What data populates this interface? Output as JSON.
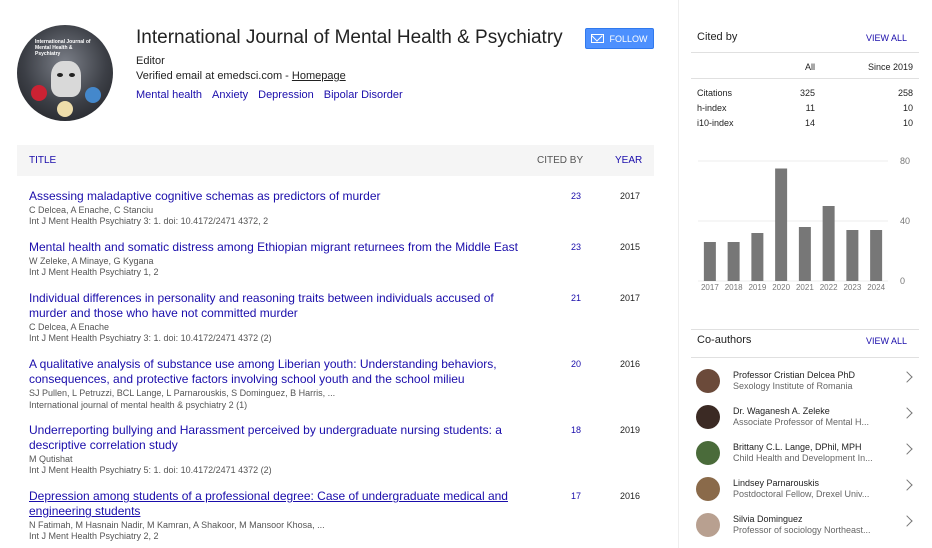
{
  "profile": {
    "name": "International Journal of Mental Health & Psychiatry",
    "role": "Editor",
    "verified_prefix": "Verified email at emedsci.com - ",
    "homepage_label": "Homepage",
    "tags": [
      "Mental health",
      "Anxiety",
      "Depression",
      "Bipolar Disorder"
    ],
    "follow_label": "FOLLOW",
    "cover_text": "International Journal of Mental Health & Psychiatry"
  },
  "table": {
    "col_title": "TITLE",
    "col_cited": "CITED BY",
    "col_year": "YEAR"
  },
  "articles": [
    {
      "title": "Assessing maladaptive cognitive schemas as predictors of murder",
      "authors": "C Delcea, A Enache, C Stanciu",
      "venue": "Int J Ment Health Psychiatry 3: 1. doi: 10.4172/2471 4372, 2",
      "cited_by": "23",
      "year": "2017"
    },
    {
      "title": "Mental health and somatic distress among Ethiopian migrant returnees from the Middle East",
      "authors": "W Zeleke, A Minaye, G Kygana",
      "venue": "Int J Ment Health Psychiatry 1, 2",
      "cited_by": "23",
      "year": "2015"
    },
    {
      "title": "Individual differences in personality and reasoning traits between individuals accused of murder and those who have not committed murder",
      "authors": "C Delcea, A Enache",
      "venue": "Int J Ment Health Psychiatry 3: 1. doi: 10.4172/2471 4372 (2)",
      "cited_by": "21",
      "year": "2017"
    },
    {
      "title": "A qualitative analysis of substance use among Liberian youth: Understanding behaviors, consequences, and protective factors involving school youth and the school milieu",
      "authors": "SJ Pullen, L Petruzzi, BCL Lange, L Parnarouskis, S Dominguez, B Harris, ...",
      "venue": "International journal of mental health & psychiatry 2 (1)",
      "cited_by": "20",
      "year": "2016"
    },
    {
      "title": "Underreporting bullying and Harassment perceived by undergraduate nursing students: a descriptive correlation study",
      "authors": "M Qutishat",
      "venue": "Int J Ment Health Psychiatry 5: 1. doi: 10.4172/2471 4372 (2)",
      "cited_by": "18",
      "year": "2019"
    },
    {
      "title": "Depression among students of a professional degree: Case of undergraduate medical and engineering students",
      "authors": "N Fatimah, M Hasnain Nadir, M Kamran, A Shakoor, M Mansoor Khosa, ...",
      "venue": "Int J Ment Health Psychiatry 2, 2",
      "cited_by": "17",
      "year": "2016"
    }
  ],
  "cited_by": {
    "heading": "Cited by",
    "view_all": "VIEW ALL",
    "col_all": "All",
    "col_since": "Since 2019",
    "rows": [
      {
        "label": "Citations",
        "all": "325",
        "since": "258"
      },
      {
        "label": "h-index",
        "all": "11",
        "since": "10"
      },
      {
        "label": "i10-index",
        "all": "14",
        "since": "10"
      }
    ]
  },
  "chart_data": {
    "type": "bar",
    "categories": [
      "2017",
      "2018",
      "2019",
      "2020",
      "2021",
      "2022",
      "2023",
      "2024"
    ],
    "values": [
      26,
      26,
      32,
      75,
      36,
      50,
      34,
      34
    ],
    "yticks": [
      "80",
      "40",
      "0"
    ],
    "ylim": [
      0,
      80
    ],
    "bar_color": "#777777"
  },
  "coauthors": {
    "heading": "Co-authors",
    "view_all": "VIEW ALL",
    "items": [
      {
        "name": "Professor Cristian Delcea PhD",
        "affiliation": "Sexology Institute of Romania",
        "avatar_color": "#6b4a3a"
      },
      {
        "name": "Dr. Waganesh A. Zeleke",
        "affiliation": "Associate Professor of Mental H...",
        "avatar_color": "#3b2a24"
      },
      {
        "name": "Brittany C.L. Lange, DPhil, MPH",
        "affiliation": "Child Health and Development In...",
        "avatar_color": "#4a6b3a"
      },
      {
        "name": "Lindsey Parnarouskis",
        "affiliation": "Postdoctoral Fellow, Drexel Univ...",
        "avatar_color": "#8a6a4a"
      },
      {
        "name": "Silvia Dominguez",
        "affiliation": "Professor of sociology Northeast...",
        "avatar_color": "#b8a090"
      }
    ]
  }
}
